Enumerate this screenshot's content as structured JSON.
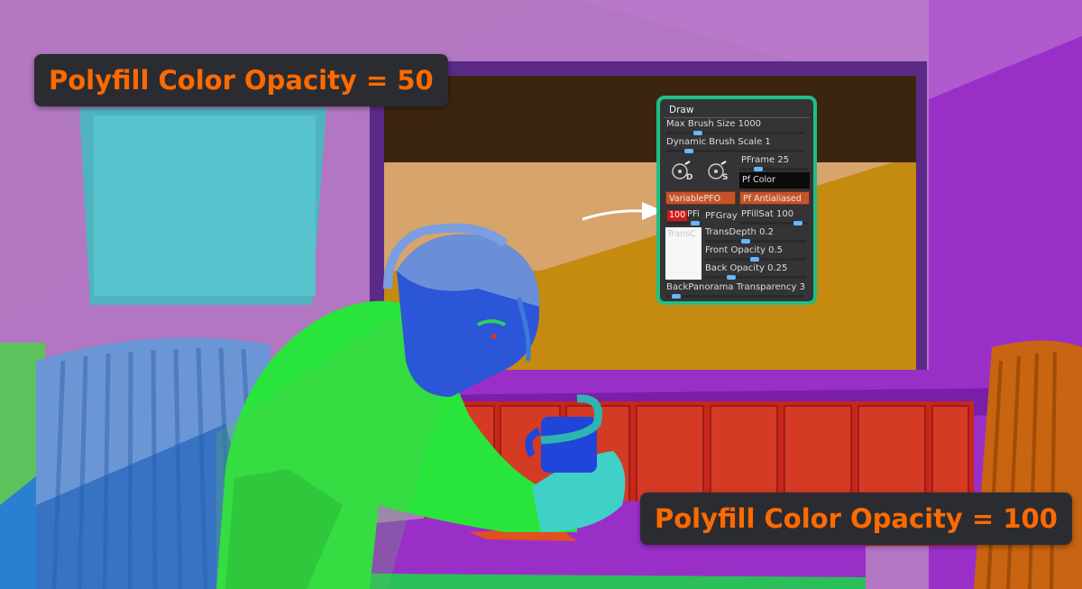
{
  "labels": {
    "top": "Polyfill Color Opacity = 50",
    "bottom": "Polyfill Color Opacity = 100"
  },
  "panel": {
    "title": "Draw",
    "max_brush_size": "Max Brush Size 1000",
    "dynamic_brush_scale": "Dynamic Brush Scale 1",
    "icon_d": "D",
    "icon_s": "S",
    "pframe": "PFrame 25",
    "pf_color": "Pf Color",
    "variable_pfo": "VariablePFO",
    "pf_antialiased": "Pf Antialiased",
    "pfi_value": "100",
    "pfi_label": "PFi",
    "pfgray": "PFGray",
    "pfillsat": "PFillSat 100",
    "transc": "TransC",
    "trans_depth": "TransDepth 0.2",
    "front_opacity": "Front Opacity 0.5",
    "back_opacity": "Back Opacity 0.25",
    "back_panorama": "BackPanorama Transparency 3"
  },
  "colors": {
    "label_text": "#ff6a00",
    "label_bg": "#2b2c31",
    "panel_border": "#1fbf86",
    "panel_bg": "#343437",
    "slider": "#5aa8ff",
    "button_orange": "#c4542a"
  },
  "icons": {
    "draw_icon": "circle-brush-icon",
    "arrow": "pointer-arrow"
  }
}
